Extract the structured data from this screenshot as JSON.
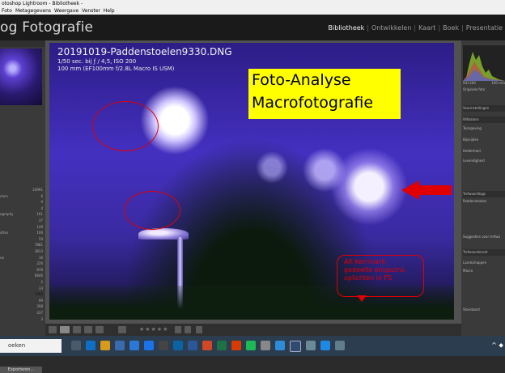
{
  "window": {
    "title": "otoshop Lightroom - Bibliotheek -",
    "menu": [
      "Foto",
      "Metagegevens",
      "Weergave",
      "Venster",
      "Help"
    ]
  },
  "header": {
    "logo": "og Fotografie",
    "modules": [
      "Bibliotheek",
      "Ontwikkelen",
      "Kaart",
      "Boek",
      "Presentatie"
    ],
    "active_module": "Bibliotheek"
  },
  "left_panel": {
    "navigator_label": "...",
    "rows": [
      {
        "label": "",
        "count": "24991"
      },
      {
        "label": "ctors",
        "count": "6"
      },
      {
        "label": "",
        "count": "0"
      },
      {
        "label": "",
        "count": "4"
      },
      {
        "label": "ography",
        "count": "161"
      },
      {
        "label": "",
        "count": "37"
      },
      {
        "label": "",
        "count": "149"
      },
      {
        "label": "ottes",
        "count": "106"
      },
      {
        "label": "",
        "count": "59"
      },
      {
        "label": "",
        "count": "7881"
      },
      {
        "label": "",
        "count": "3813"
      },
      {
        "label": "na",
        "count": "16"
      },
      {
        "label": "",
        "count": "226"
      },
      {
        "label": "",
        "count": "878"
      },
      {
        "label": "",
        "count": "6846"
      },
      {
        "label": "",
        "count": "2"
      },
      {
        "label": "",
        "count": "33"
      },
      {
        "label": "",
        "count": "1092"
      },
      {
        "label": "",
        "count": "99"
      },
      {
        "label": "",
        "count": "398"
      },
      {
        "label": "",
        "count": "437"
      },
      {
        "label": "",
        "count": "3"
      }
    ],
    "export_label": "Exporteren..."
  },
  "photo": {
    "filename": "20191019-Paddenstoelen9330.DNG",
    "exposure": "1/50 sec. bij ƒ / 4,5, ISO 200",
    "lens": "100 mm (EF100mm f/2.8L Macro IS USM)",
    "overlay_title_line1": "Foto-Analyse",
    "overlay_title_line2": "Macrofotografie",
    "annotation_line1": "Alt Ken'mark",
    "annotation_line2": "gedeelte enigszins",
    "annotation_line3": "oplichten in PS"
  },
  "right_panel": {
    "histogram_iso": "ISO 200",
    "histogram_lens": "100 mm",
    "original_photo": "Originele foto",
    "rows": [
      "Voorinstellingen",
      "Witbalans",
      "Toongeving",
      "Bijsnijden",
      "Helderheid",
      "Levendigheid",
      "Trefwoordtags",
      "Paddenstoelen",
      "Suggesties voor trefwo",
      "Trefwoordenset",
      "Landschappen",
      "Macro",
      "Standaard"
    ]
  },
  "toolbar": {
    "stars": "★★★★★"
  },
  "taskbar": {
    "search_text": "oeken",
    "tray": "^ ⬥"
  },
  "colors": {
    "annotation_red": "#e00000",
    "highlight_yellow": "#ffff00"
  }
}
